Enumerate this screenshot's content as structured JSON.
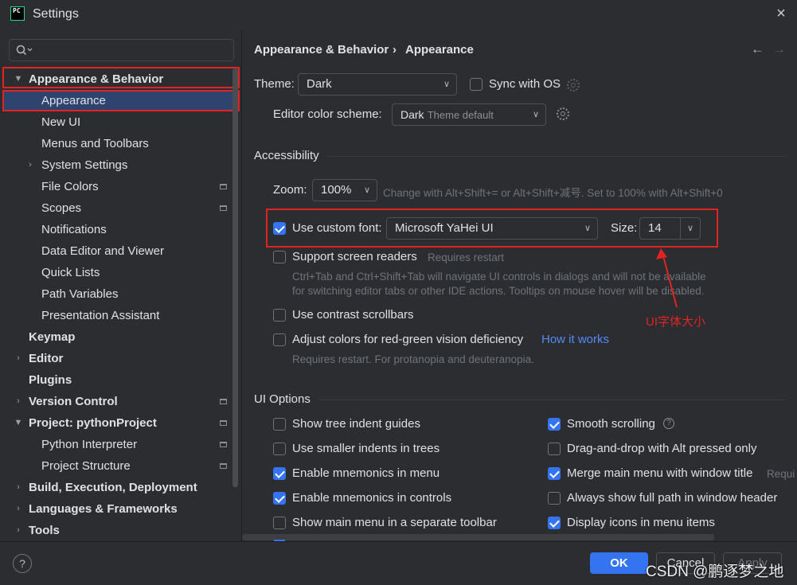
{
  "window": {
    "title": "Settings",
    "app_icon_text": "PC",
    "close_glyph": "×"
  },
  "search": {
    "placeholder": ""
  },
  "sidebar": {
    "items": [
      {
        "label": "Appearance & Behavior",
        "expanded": true
      },
      {
        "label": "Appearance",
        "selected": true
      },
      {
        "label": "New UI"
      },
      {
        "label": "Menus and Toolbars"
      },
      {
        "label": "System Settings",
        "collapsed": true
      },
      {
        "label": "File Colors"
      },
      {
        "label": "Scopes"
      },
      {
        "label": "Notifications"
      },
      {
        "label": "Data Editor and Viewer"
      },
      {
        "label": "Quick Lists"
      },
      {
        "label": "Path Variables"
      },
      {
        "label": "Presentation Assistant"
      },
      {
        "label": "Keymap"
      },
      {
        "label": "Editor"
      },
      {
        "label": "Plugins"
      },
      {
        "label": "Version Control"
      },
      {
        "label": "Project: pythonProject"
      },
      {
        "label": "Python Interpreter"
      },
      {
        "label": "Project Structure"
      },
      {
        "label": "Build, Execution, Deployment"
      },
      {
        "label": "Languages & Frameworks"
      },
      {
        "label": "Tools"
      }
    ]
  },
  "breadcrumb": {
    "parent": "Appearance & Behavior",
    "separator": "›",
    "current": "Appearance"
  },
  "nav": {
    "back": "←",
    "forward": "→"
  },
  "theme": {
    "label": "Theme:",
    "value": "Dark",
    "sync_label": "Sync with OS",
    "sync_checked": false
  },
  "editor_scheme": {
    "label": "Editor color scheme:",
    "value_main": "Dark",
    "value_sub": "Theme default"
  },
  "accessibility": {
    "title": "Accessibility",
    "zoom_label": "Zoom:",
    "zoom_value": "100%",
    "zoom_hint": "Change with Alt+Shift+= or Alt+Shift+减号. Set to 100% with Alt+Shift+0",
    "custom_font_label": "Use custom font:",
    "custom_font_checked": true,
    "font_value": "Microsoft YaHei UI",
    "size_label": "Size:",
    "size_value": "14",
    "screen_readers_label": "Support screen readers",
    "screen_readers_note": "Requires restart",
    "screen_readers_desc1": "Ctrl+Tab and Ctrl+Shift+Tab will navigate UI controls in dialogs and will not be available",
    "screen_readers_desc2": "for switching editor tabs or other IDE actions. Tooltips on mouse hover will be disabled.",
    "contrast_label": "Use contrast scrollbars",
    "color_adjust_label": "Adjust colors for red-green vision deficiency",
    "how_it_works": "How it works",
    "color_adjust_desc": "Requires restart. For protanopia and deuteranopia."
  },
  "annotation": {
    "text": "UI字体大小",
    "color": "#e02424"
  },
  "ui_options": {
    "title": "UI Options",
    "left": [
      {
        "label": "Show tree indent guides",
        "checked": false
      },
      {
        "label": "Use smaller indents in trees",
        "checked": false
      },
      {
        "label": "Enable mnemonics in menu",
        "checked": true
      },
      {
        "label": "Enable mnemonics in controls",
        "checked": true
      },
      {
        "label": "Show main menu in a separate toolbar",
        "checked": false
      }
    ],
    "right": [
      {
        "label": "Smooth scrolling",
        "checked": true
      },
      {
        "label": "Drag-and-drop with Alt pressed only",
        "checked": false
      },
      {
        "label": "Merge main menu with window title",
        "checked": true,
        "note": "Requi"
      },
      {
        "label": "Always show full path in window header",
        "checked": false
      },
      {
        "label": "Display icons in menu items",
        "checked": true
      }
    ]
  },
  "footer": {
    "help": "?",
    "ok": "OK",
    "cancel": "Cancel",
    "apply": "Apply"
  },
  "watermark": "CSDN @鹏逐梦之地",
  "colors": {
    "accent": "#3574f0",
    "selection": "#2e436e",
    "background": "#2b2d30",
    "highlight_box": "#e02424"
  }
}
